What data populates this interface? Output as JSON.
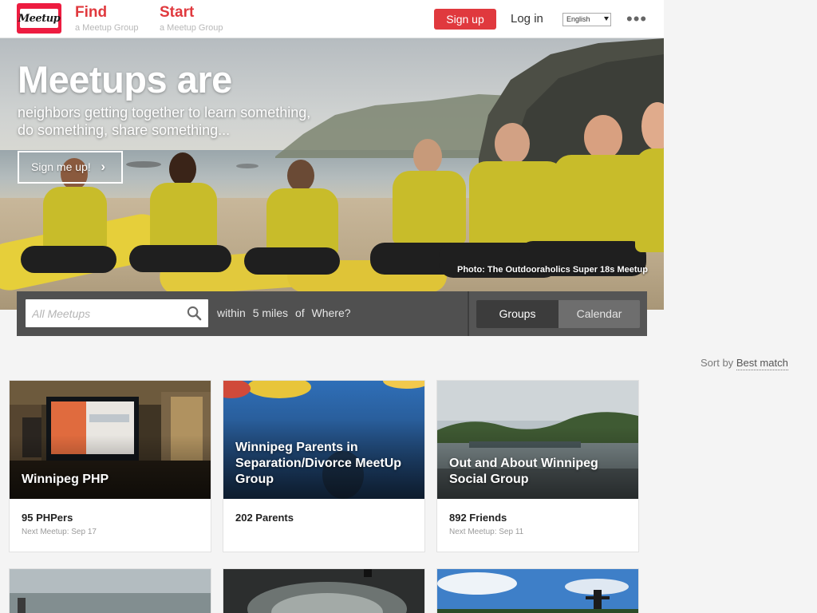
{
  "header": {
    "logo_text": "Meetup",
    "find": {
      "label": "Find",
      "sub": "a Meetup Group"
    },
    "start": {
      "label": "Start",
      "sub": "a Meetup Group"
    },
    "signup_label": "Sign up",
    "login_label": "Log in",
    "language": "English",
    "more_icon": "•••",
    "colors": {
      "brand": "#e0393e"
    }
  },
  "hero": {
    "title": "Meetups are",
    "subtitle_line1": "neighbors getting together to learn something,",
    "subtitle_line2": "do something, share something...",
    "cta_label": "Sign me up!",
    "cta_icon": "›",
    "photo_credit": "Photo: The Outdooraholics Super 18s Meetup"
  },
  "search": {
    "placeholder": "All Meetups",
    "within_label": "within",
    "distance": "5 miles",
    "of_label": "of",
    "location": "Where?",
    "tabs": [
      {
        "label": "Groups",
        "active": true
      },
      {
        "label": "Calendar",
        "active": false
      }
    ]
  },
  "sort": {
    "label": "Sort by",
    "value": "Best match"
  },
  "groups": [
    {
      "title": "Winnipeg PHP",
      "count": "95 PHPers",
      "next": "Next Meetup: Sep 17"
    },
    {
      "title": "Winnipeg Parents in Separation/Divorce MeetUp Group",
      "count": "202 Parents",
      "next": ""
    },
    {
      "title": "Out and About Winnipeg Social Group",
      "count": "892 Friends",
      "next": "Next Meetup: Sep 11"
    }
  ]
}
